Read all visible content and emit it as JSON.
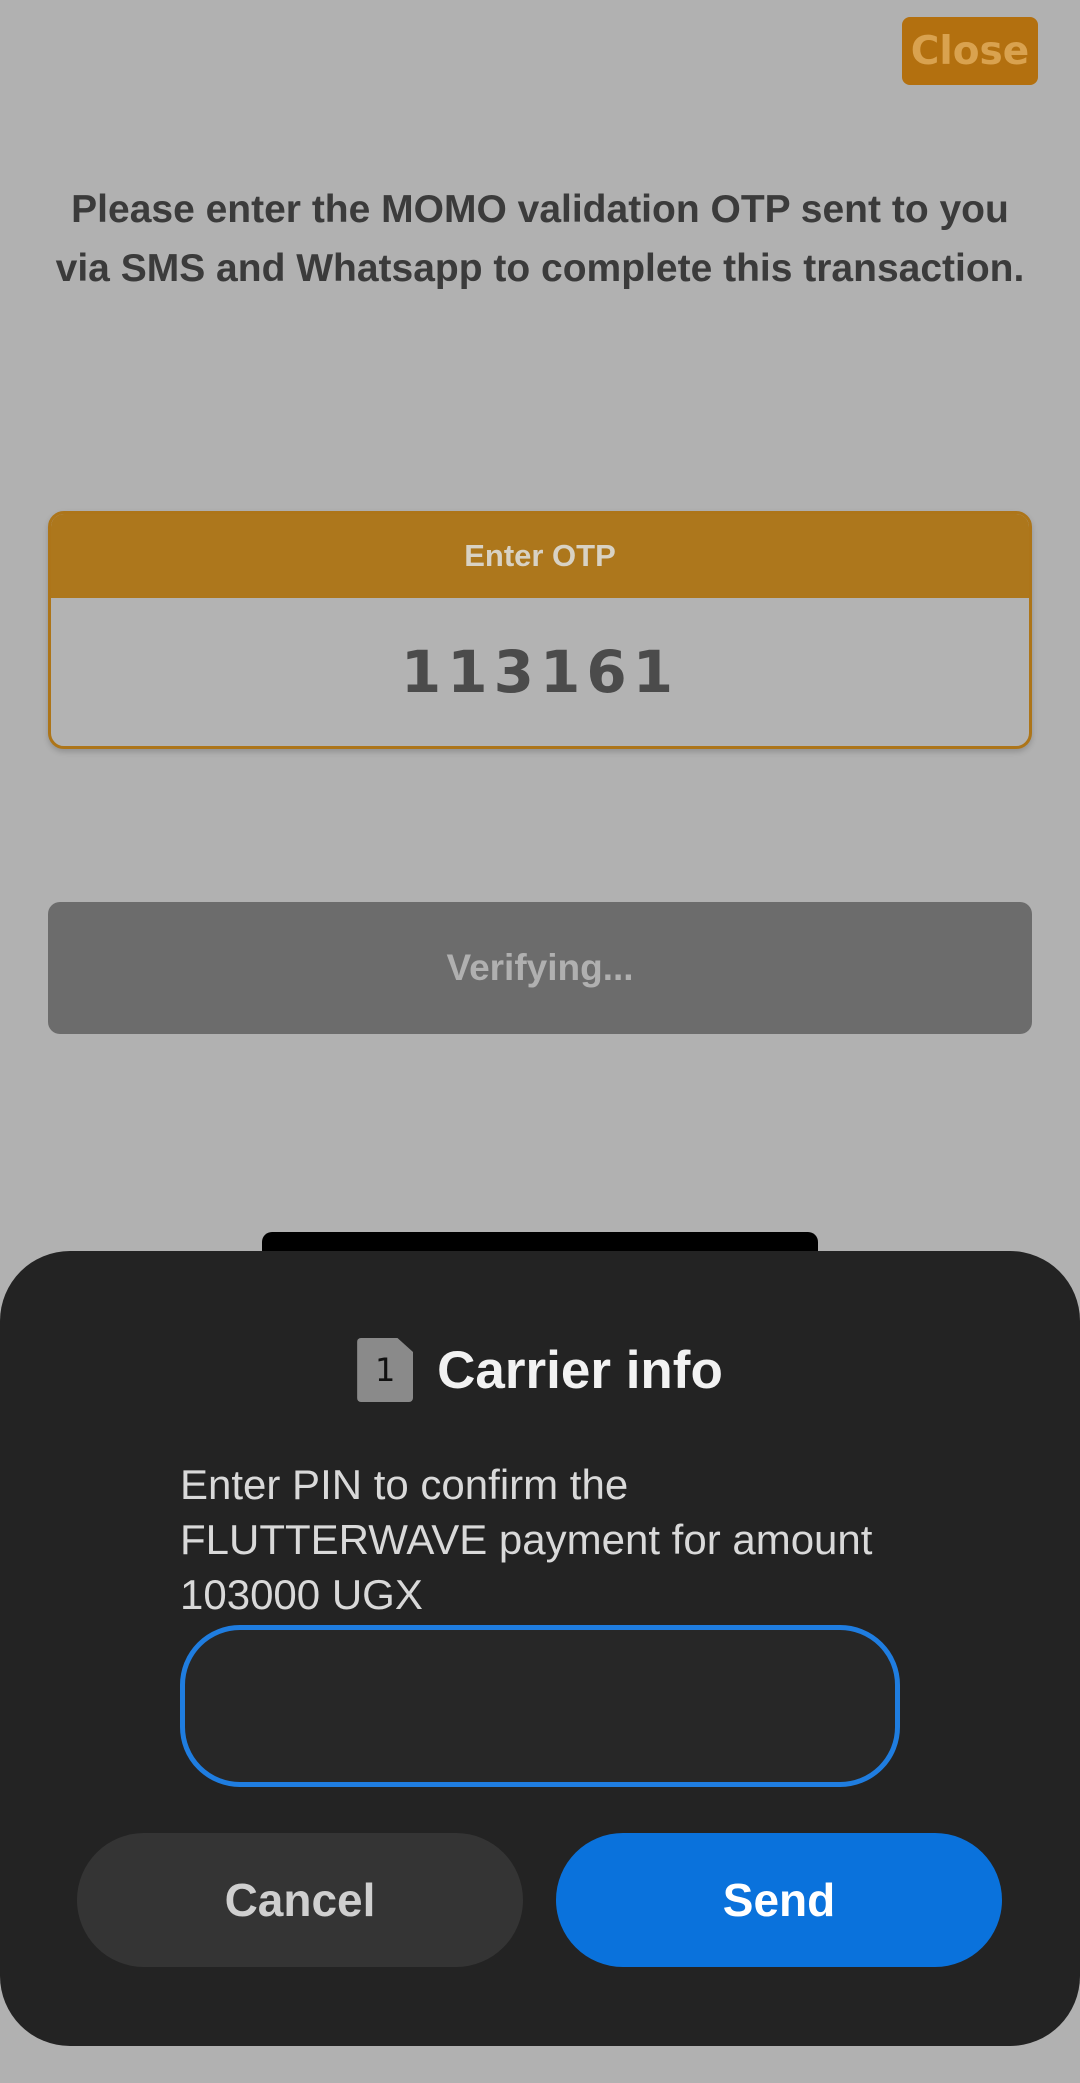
{
  "app": {
    "close_label": "Close",
    "instruction": "Please enter the MOMO validation OTP sent to you via SMS and Whatsapp to complete this transaction.",
    "otp_header": "Enter OTP",
    "otp_value": "113161",
    "verify_label": "Verifying..."
  },
  "dialog": {
    "sim_number": "1",
    "title": "Carrier info",
    "message": "Enter PIN to confirm the FLUTTERWAVE payment for amount 103000 UGX",
    "pin_value": "",
    "cancel_label": "Cancel",
    "send_label": "Send"
  },
  "colors": {
    "accent": "#ad771c",
    "send_blue": "#0a72dc",
    "input_focus": "#1f7de0"
  }
}
